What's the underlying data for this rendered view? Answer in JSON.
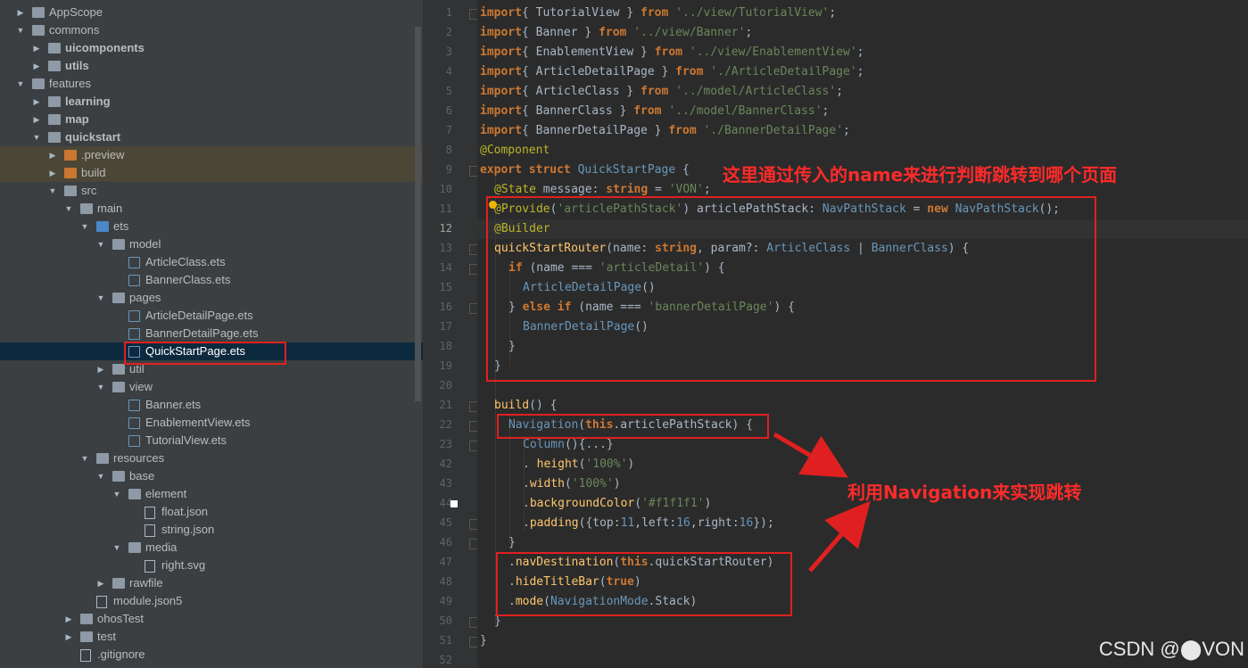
{
  "tree": [
    {
      "label": "AppScope",
      "depth": 0,
      "exp": false,
      "icon": "folder",
      "bold": false
    },
    {
      "label": "commons",
      "depth": 0,
      "exp": true,
      "icon": "folder",
      "bold": false
    },
    {
      "label": "uicomponents",
      "depth": 1,
      "exp": false,
      "icon": "folder",
      "bold": true
    },
    {
      "label": "utils",
      "depth": 1,
      "exp": false,
      "icon": "folder",
      "bold": true
    },
    {
      "label": "features",
      "depth": 0,
      "exp": true,
      "icon": "folder",
      "bold": false
    },
    {
      "label": "learning",
      "depth": 1,
      "exp": false,
      "icon": "folder",
      "bold": true
    },
    {
      "label": "map",
      "depth": 1,
      "exp": false,
      "icon": "folder",
      "bold": true
    },
    {
      "label": "quickstart",
      "depth": 1,
      "exp": true,
      "icon": "folder",
      "bold": true
    },
    {
      "label": ".preview",
      "depth": 2,
      "exp": false,
      "icon": "folder-orange",
      "bold": false,
      "hl": true
    },
    {
      "label": "build",
      "depth": 2,
      "exp": false,
      "icon": "folder-orange",
      "bold": false,
      "hl": true
    },
    {
      "label": "src",
      "depth": 2,
      "exp": true,
      "icon": "folder",
      "bold": false
    },
    {
      "label": "main",
      "depth": 3,
      "exp": true,
      "icon": "folder",
      "bold": false
    },
    {
      "label": "ets",
      "depth": 4,
      "exp": true,
      "icon": "folder-blue",
      "bold": false
    },
    {
      "label": "model",
      "depth": 5,
      "exp": true,
      "icon": "folder",
      "bold": false
    },
    {
      "label": "ArticleClass.ets",
      "depth": 6,
      "exp": null,
      "icon": "ets",
      "bold": false
    },
    {
      "label": "BannerClass.ets",
      "depth": 6,
      "exp": null,
      "icon": "ets",
      "bold": false
    },
    {
      "label": "pages",
      "depth": 5,
      "exp": true,
      "icon": "folder",
      "bold": false
    },
    {
      "label": "ArticleDetailPage.ets",
      "depth": 6,
      "exp": null,
      "icon": "ets",
      "bold": false
    },
    {
      "label": "BannerDetailPage.ets",
      "depth": 6,
      "exp": null,
      "icon": "ets",
      "bold": false
    },
    {
      "label": "QuickStartPage.ets",
      "depth": 6,
      "exp": null,
      "icon": "ets",
      "bold": false,
      "sel": true
    },
    {
      "label": "util",
      "depth": 5,
      "exp": false,
      "icon": "folder",
      "bold": false
    },
    {
      "label": "view",
      "depth": 5,
      "exp": true,
      "icon": "folder",
      "bold": false
    },
    {
      "label": "Banner.ets",
      "depth": 6,
      "exp": null,
      "icon": "ets",
      "bold": false
    },
    {
      "label": "EnablementView.ets",
      "depth": 6,
      "exp": null,
      "icon": "ets",
      "bold": false
    },
    {
      "label": "TutorialView.ets",
      "depth": 6,
      "exp": null,
      "icon": "ets",
      "bold": false
    },
    {
      "label": "resources",
      "depth": 4,
      "exp": true,
      "icon": "folder",
      "bold": false
    },
    {
      "label": "base",
      "depth": 5,
      "exp": true,
      "icon": "folder",
      "bold": false
    },
    {
      "label": "element",
      "depth": 6,
      "exp": true,
      "icon": "folder",
      "bold": false
    },
    {
      "label": "float.json",
      "depth": 7,
      "exp": null,
      "icon": "json",
      "bold": false
    },
    {
      "label": "string.json",
      "depth": 7,
      "exp": null,
      "icon": "json",
      "bold": false
    },
    {
      "label": "media",
      "depth": 6,
      "exp": true,
      "icon": "folder",
      "bold": false
    },
    {
      "label": "right.svg",
      "depth": 7,
      "exp": null,
      "icon": "json",
      "bold": false
    },
    {
      "label": "rawfile",
      "depth": 5,
      "exp": false,
      "icon": "folder",
      "bold": false
    },
    {
      "label": "module.json5",
      "depth": 4,
      "exp": null,
      "icon": "json",
      "bold": false
    },
    {
      "label": "ohosTest",
      "depth": 3,
      "exp": false,
      "icon": "folder",
      "bold": false
    },
    {
      "label": "test",
      "depth": 3,
      "exp": false,
      "icon": "folder",
      "bold": false
    },
    {
      "label": ".gitignore",
      "depth": 3,
      "exp": null,
      "icon": "json",
      "bold": false
    }
  ],
  "line_numbers": [
    "1",
    "2",
    "3",
    "4",
    "5",
    "6",
    "7",
    "8",
    "9",
    "10",
    "11",
    "12",
    "13",
    "14",
    "15",
    "16",
    "17",
    "18",
    "19",
    "20",
    "21",
    "22",
    "23",
    "42",
    "43",
    "44",
    "45",
    "46",
    "47",
    "48",
    "49",
    "50",
    "51",
    "52"
  ],
  "code": [
    {
      "indent": 0,
      "t": [
        [
          "kw",
          "import"
        ],
        [
          "",
          "{ TutorialView } "
        ],
        [
          "kw",
          "from"
        ],
        [
          "",
          " "
        ],
        [
          "str",
          "'../view/TutorialView'"
        ],
        [
          "",
          ";"
        ]
      ]
    },
    {
      "indent": 0,
      "t": [
        [
          "kw",
          "import"
        ],
        [
          "",
          "{ Banner } "
        ],
        [
          "kw",
          "from"
        ],
        [
          "",
          " "
        ],
        [
          "str",
          "'../view/Banner'"
        ],
        [
          "",
          ";"
        ]
      ]
    },
    {
      "indent": 0,
      "t": [
        [
          "kw",
          "import"
        ],
        [
          "",
          "{ EnablementView } "
        ],
        [
          "kw",
          "from"
        ],
        [
          "",
          " "
        ],
        [
          "str",
          "'../view/EnablementView'"
        ],
        [
          "",
          ";"
        ]
      ]
    },
    {
      "indent": 0,
      "t": [
        [
          "kw",
          "import"
        ],
        [
          "",
          "{ ArticleDetailPage } "
        ],
        [
          "kw",
          "from"
        ],
        [
          "",
          " "
        ],
        [
          "str",
          "'./ArticleDetailPage'"
        ],
        [
          "",
          ";"
        ]
      ]
    },
    {
      "indent": 0,
      "t": [
        [
          "kw",
          "import"
        ],
        [
          "",
          "{ ArticleClass } "
        ],
        [
          "kw",
          "from"
        ],
        [
          "",
          " "
        ],
        [
          "str",
          "'../model/ArticleClass'"
        ],
        [
          "",
          ";"
        ]
      ]
    },
    {
      "indent": 0,
      "t": [
        [
          "kw",
          "import"
        ],
        [
          "",
          "{ BannerClass } "
        ],
        [
          "kw",
          "from"
        ],
        [
          "",
          " "
        ],
        [
          "str",
          "'../model/BannerClass'"
        ],
        [
          "",
          ";"
        ]
      ]
    },
    {
      "indent": 0,
      "t": [
        [
          "kw",
          "import"
        ],
        [
          "",
          "{ BannerDetailPage } "
        ],
        [
          "kw",
          "from"
        ],
        [
          "",
          " "
        ],
        [
          "str",
          "'./BannerDetailPage'"
        ],
        [
          "",
          ";"
        ]
      ]
    },
    {
      "indent": 0,
      "t": [
        [
          "ann",
          "@Component"
        ]
      ]
    },
    {
      "indent": 0,
      "t": [
        [
          "kw",
          "export struct"
        ],
        [
          "",
          " "
        ],
        [
          "ty",
          "QuickStartPage"
        ],
        [
          "",
          " {"
        ]
      ]
    },
    {
      "indent": 1,
      "t": [
        [
          "ann",
          "@State"
        ],
        [
          "",
          " message: "
        ],
        [
          "kw",
          "string"
        ],
        [
          "",
          " = "
        ],
        [
          "str",
          "'VON'"
        ],
        [
          "",
          ";"
        ]
      ]
    },
    {
      "indent": 1,
      "t": [
        [
          "ann",
          "@Provide"
        ],
        [
          "",
          "("
        ],
        [
          "str",
          "'articlePathStack'"
        ],
        [
          "",
          ") articlePathStack: "
        ],
        [
          "ty",
          "NavPathStack"
        ],
        [
          "",
          " = "
        ],
        [
          "kw",
          "new"
        ],
        [
          "",
          " "
        ],
        [
          "ty",
          "NavPathStack"
        ],
        [
          "",
          "();"
        ]
      ]
    },
    {
      "indent": 1,
      "t": [
        [
          "ann",
          "@Builder"
        ]
      ]
    },
    {
      "indent": 1,
      "t": [
        [
          "fn",
          "quickStartRouter"
        ],
        [
          "",
          "(name: "
        ],
        [
          "kw",
          "string"
        ],
        [
          "",
          ", param?: "
        ],
        [
          "ty",
          "ArticleClass"
        ],
        [
          "",
          " | "
        ],
        [
          "ty",
          "BannerClass"
        ],
        [
          "",
          ") {"
        ]
      ]
    },
    {
      "indent": 2,
      "t": [
        [
          "kw",
          "if"
        ],
        [
          "",
          " (name === "
        ],
        [
          "str",
          "'articleDetail'"
        ],
        [
          "",
          ") {"
        ]
      ]
    },
    {
      "indent": 3,
      "t": [
        [
          "ty",
          "ArticleDetailPage"
        ],
        [
          "",
          "()"
        ]
      ]
    },
    {
      "indent": 2,
      "t": [
        [
          "",
          "} "
        ],
        [
          "kw",
          "else if"
        ],
        [
          "",
          " (name === "
        ],
        [
          "str",
          "'bannerDetailPage'"
        ],
        [
          "",
          ") {"
        ]
      ]
    },
    {
      "indent": 3,
      "t": [
        [
          "ty",
          "BannerDetailPage"
        ],
        [
          "",
          "()"
        ]
      ]
    },
    {
      "indent": 2,
      "t": [
        [
          "",
          "}"
        ]
      ]
    },
    {
      "indent": 1,
      "t": [
        [
          "",
          "}"
        ]
      ]
    },
    {
      "indent": 0,
      "t": []
    },
    {
      "indent": 1,
      "t": [
        [
          "fn",
          "build"
        ],
        [
          "",
          "() {"
        ]
      ]
    },
    {
      "indent": 2,
      "t": [
        [
          "ty",
          "Navigation"
        ],
        [
          "",
          "("
        ],
        [
          "kw",
          "this"
        ],
        [
          "",
          ".articlePathStack) {"
        ]
      ]
    },
    {
      "indent": 3,
      "t": [
        [
          "ty",
          "Column"
        ],
        [
          "",
          "(){...}"
        ]
      ]
    },
    {
      "indent": 3,
      "t": [
        [
          "",
          ". "
        ],
        [
          "fn",
          "height"
        ],
        [
          "",
          "("
        ],
        [
          "str",
          "'100%'"
        ],
        [
          "",
          ")"
        ]
      ]
    },
    {
      "indent": 3,
      "t": [
        [
          "",
          "."
        ],
        [
          "fn",
          "width"
        ],
        [
          "",
          "("
        ],
        [
          "str",
          "'100%'"
        ],
        [
          "",
          ")"
        ]
      ]
    },
    {
      "indent": 3,
      "t": [
        [
          "",
          "."
        ],
        [
          "fn",
          "backgroundColor"
        ],
        [
          "",
          "("
        ],
        [
          "str",
          "'#f1f1f1'"
        ],
        [
          "",
          ")"
        ]
      ]
    },
    {
      "indent": 3,
      "t": [
        [
          "",
          "."
        ],
        [
          "fn",
          "padding"
        ],
        [
          "",
          "({top:"
        ],
        [
          "num",
          "11"
        ],
        [
          "",
          ",left:"
        ],
        [
          "num",
          "16"
        ],
        [
          "",
          ",right:"
        ],
        [
          "num",
          "16"
        ],
        [
          "",
          "});"
        ]
      ]
    },
    {
      "indent": 2,
      "t": [
        [
          "",
          "}"
        ]
      ]
    },
    {
      "indent": 2,
      "t": [
        [
          "",
          "."
        ],
        [
          "fn",
          "navDestination"
        ],
        [
          "",
          "("
        ],
        [
          "kw",
          "this"
        ],
        [
          "",
          ".quickStartRouter)"
        ]
      ]
    },
    {
      "indent": 2,
      "t": [
        [
          "",
          "."
        ],
        [
          "fn",
          "hideTitleBar"
        ],
        [
          "",
          "("
        ],
        [
          "kw",
          "true"
        ],
        [
          "",
          ")"
        ]
      ]
    },
    {
      "indent": 2,
      "t": [
        [
          "",
          "."
        ],
        [
          "fn",
          "mode"
        ],
        [
          "",
          "("
        ],
        [
          "ty",
          "NavigationMode"
        ],
        [
          "",
          ".Stack)"
        ]
      ]
    },
    {
      "indent": 1,
      "t": [
        [
          "",
          "}"
        ]
      ]
    },
    {
      "indent": 0,
      "t": [
        [
          "",
          "}"
        ]
      ]
    },
    {
      "indent": 0,
      "t": []
    }
  ],
  "annotations": {
    "note_top": "这里通过传入的name来进行判断跳转到哪个页面",
    "note_nav": "利用Navigation来实现跳转"
  },
  "watermark": "CSDN @⬤VON"
}
